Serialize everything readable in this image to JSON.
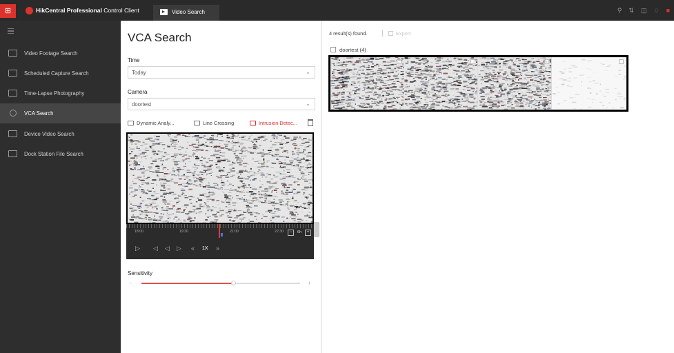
{
  "titlebar": {
    "app_title_bold": "HikCentral Professional",
    "app_title_rest": " Control Client",
    "tab_label": "Video Search",
    "right_icons": [
      "user-icon",
      "transfer-icon",
      "layout-icon",
      "bell-icon",
      "alert-icon"
    ]
  },
  "sidebar": {
    "items": [
      {
        "label": "Video Footage Search",
        "icon": "video-icon"
      },
      {
        "label": "Scheduled Capture Search",
        "icon": "capture-icon"
      },
      {
        "label": "Time-Lapse Photography",
        "icon": "timelapse-icon"
      },
      {
        "label": "VCA Search",
        "icon": "search-icon",
        "active": true
      },
      {
        "label": "Device Video Search",
        "icon": "device-icon"
      },
      {
        "label": "Dock Station File Search",
        "icon": "dock-icon"
      }
    ]
  },
  "panel": {
    "title": "VCA Search",
    "time_label": "Time",
    "time_value": "Today",
    "camera_label": "Camera",
    "camera_value": "doortest",
    "rules": [
      "Dynamic Analy...",
      "Line Crossing",
      "Intrusion Detec..."
    ],
    "active_rule_index": 2,
    "timeline": {
      "labels": [
        "18:00",
        "19:30",
        "21:00",
        "22:30"
      ],
      "zoom": "6h"
    },
    "speed": "1X",
    "sensitivity_label": "Sensitivity",
    "sensitivity_level": 0.58,
    "minus": "−",
    "plus": "+"
  },
  "results": {
    "count_text": "4 result(s) found.",
    "export_label": "Export",
    "group_label": "doortest (4)",
    "thumbnails": 4
  },
  "colors": {
    "accent": "#d9332c",
    "sidebar_bg": "#2e2e2e",
    "titlebar_bg": "#2a2a2a"
  }
}
